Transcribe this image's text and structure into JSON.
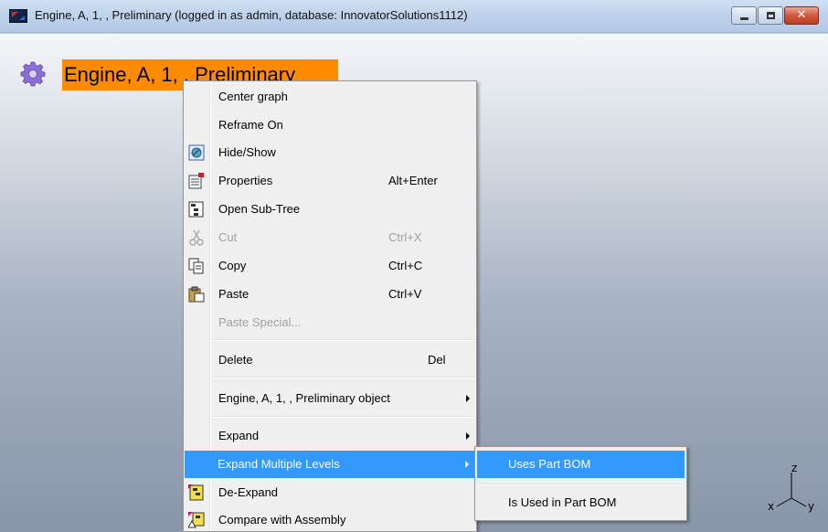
{
  "window": {
    "title": "Engine, A, 1, , Preliminary (logged in as admin, database: InnovatorSolutions1112)",
    "icon": "aras-app-icon",
    "controls": [
      "minimize",
      "maximize",
      "close"
    ]
  },
  "graph": {
    "node_label": "Engine, A, 1, , Preliminary",
    "node_icon": "gear-icon",
    "node_color": "#ff8c00",
    "triad": {
      "z": "z",
      "x": "x",
      "y": "y"
    }
  },
  "context_menu": {
    "items": [
      {
        "label": "Center graph",
        "shortcut": "",
        "icon": "",
        "enabled": true
      },
      {
        "label": "Reframe On",
        "shortcut": "",
        "icon": "",
        "enabled": true
      },
      {
        "label": "Hide/Show",
        "shortcut": "",
        "icon": "hide-show-icon",
        "enabled": true
      },
      {
        "label": "Properties",
        "shortcut": "Alt+Enter",
        "icon": "properties-icon",
        "enabled": true
      },
      {
        "label": "Open Sub-Tree",
        "shortcut": "",
        "icon": "sub-tree-icon",
        "enabled": true
      },
      {
        "label": "Cut",
        "shortcut": "Ctrl+X",
        "icon": "scissors-icon",
        "enabled": false
      },
      {
        "label": "Copy",
        "shortcut": "Ctrl+C",
        "icon": "copy-icon",
        "enabled": true
      },
      {
        "label": "Paste",
        "shortcut": "Ctrl+V",
        "icon": "paste-icon",
        "enabled": true
      },
      {
        "label": "Paste Special...",
        "shortcut": "",
        "icon": "",
        "enabled": false
      },
      {
        "label": "Delete",
        "shortcut": "Del",
        "icon": "",
        "enabled": true
      },
      {
        "label": "Engine, A, 1, , Preliminary object",
        "shortcut": "",
        "icon": "",
        "enabled": true,
        "submenu": true
      },
      {
        "label": "Expand",
        "shortcut": "",
        "icon": "",
        "enabled": true,
        "submenu": true
      },
      {
        "label": "Expand Multiple Levels",
        "shortcut": "",
        "icon": "",
        "enabled": true,
        "submenu": true,
        "highlighted": true
      },
      {
        "label": "De-Expand",
        "shortcut": "",
        "icon": "de-expand-icon",
        "enabled": true
      },
      {
        "label": "Compare with Assembly",
        "shortcut": "",
        "icon": "compare-icon",
        "enabled": true
      }
    ]
  },
  "submenu": {
    "items": [
      {
        "label": "Uses Part BOM",
        "highlighted": true
      },
      {
        "label": "Is Used in Part BOM",
        "highlighted": false
      }
    ]
  },
  "colors": {
    "highlight": "#3399ff",
    "menu_bg": "#f0f0f0",
    "disabled_text": "#a0a0a0"
  }
}
